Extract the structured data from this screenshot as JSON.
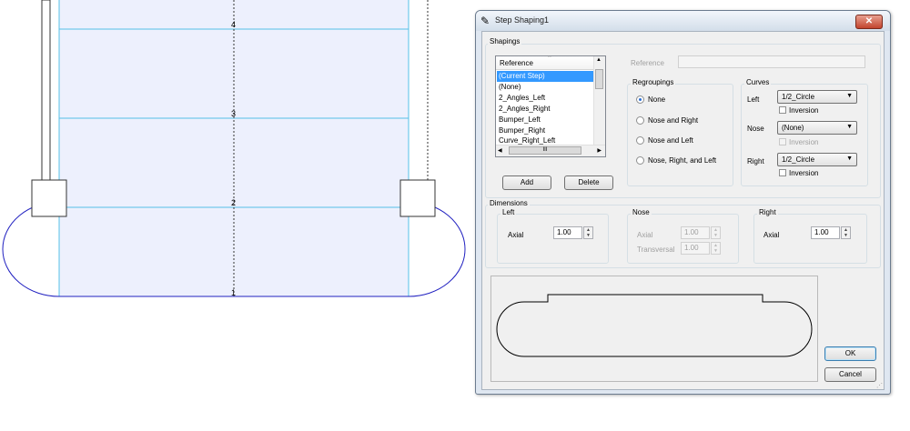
{
  "canvas": {
    "row_labels": [
      "4",
      "3",
      "2",
      "1"
    ],
    "grid_color": "#55c0e8",
    "fill_color": "#edf0fd",
    "outline_color": "#2020c0"
  },
  "dialog": {
    "title": "Step Shaping1",
    "close_label": "✕",
    "shapings": {
      "group_label": "Shapings",
      "list_header": "Reference",
      "items": [
        "(Current Step)",
        "(None)",
        "2_Angles_Left",
        "2_Angles_Right",
        "Bumper_Left",
        "Bumper_Right",
        "Curve_Right_Left"
      ],
      "selected": "(Current Step)",
      "scroll_thumb_label": "III",
      "add_label": "Add",
      "delete_label": "Delete"
    },
    "reference": {
      "label": "Reference",
      "value": ""
    },
    "regroupings": {
      "group_label": "Regroupings",
      "options": [
        "None",
        "Nose and Right",
        "Nose and Left",
        "Nose, Right, and Left"
      ],
      "selected": "None"
    },
    "curves": {
      "group_label": "Curves",
      "left_label": "Left",
      "left_value": "1/2_Circle",
      "nose_label": "Nose",
      "nose_value": "(None)",
      "right_label": "Right",
      "right_value": "1/2_Circle",
      "inversion_label": "Inversion"
    },
    "dimensions": {
      "group_label": "Dimensions",
      "left_label": "Left",
      "left_axial_label": "Axial",
      "left_axial_value": "1.00",
      "nose_label": "Nose",
      "nose_axial_label": "Axial",
      "nose_axial_value": "1.00",
      "nose_transversal_label": "Transversal",
      "nose_transversal_value": "1.00",
      "right_label": "Right",
      "right_axial_label": "Axial",
      "right_axial_value": "1.00"
    },
    "ok_label": "OK",
    "cancel_label": "Cancel"
  }
}
